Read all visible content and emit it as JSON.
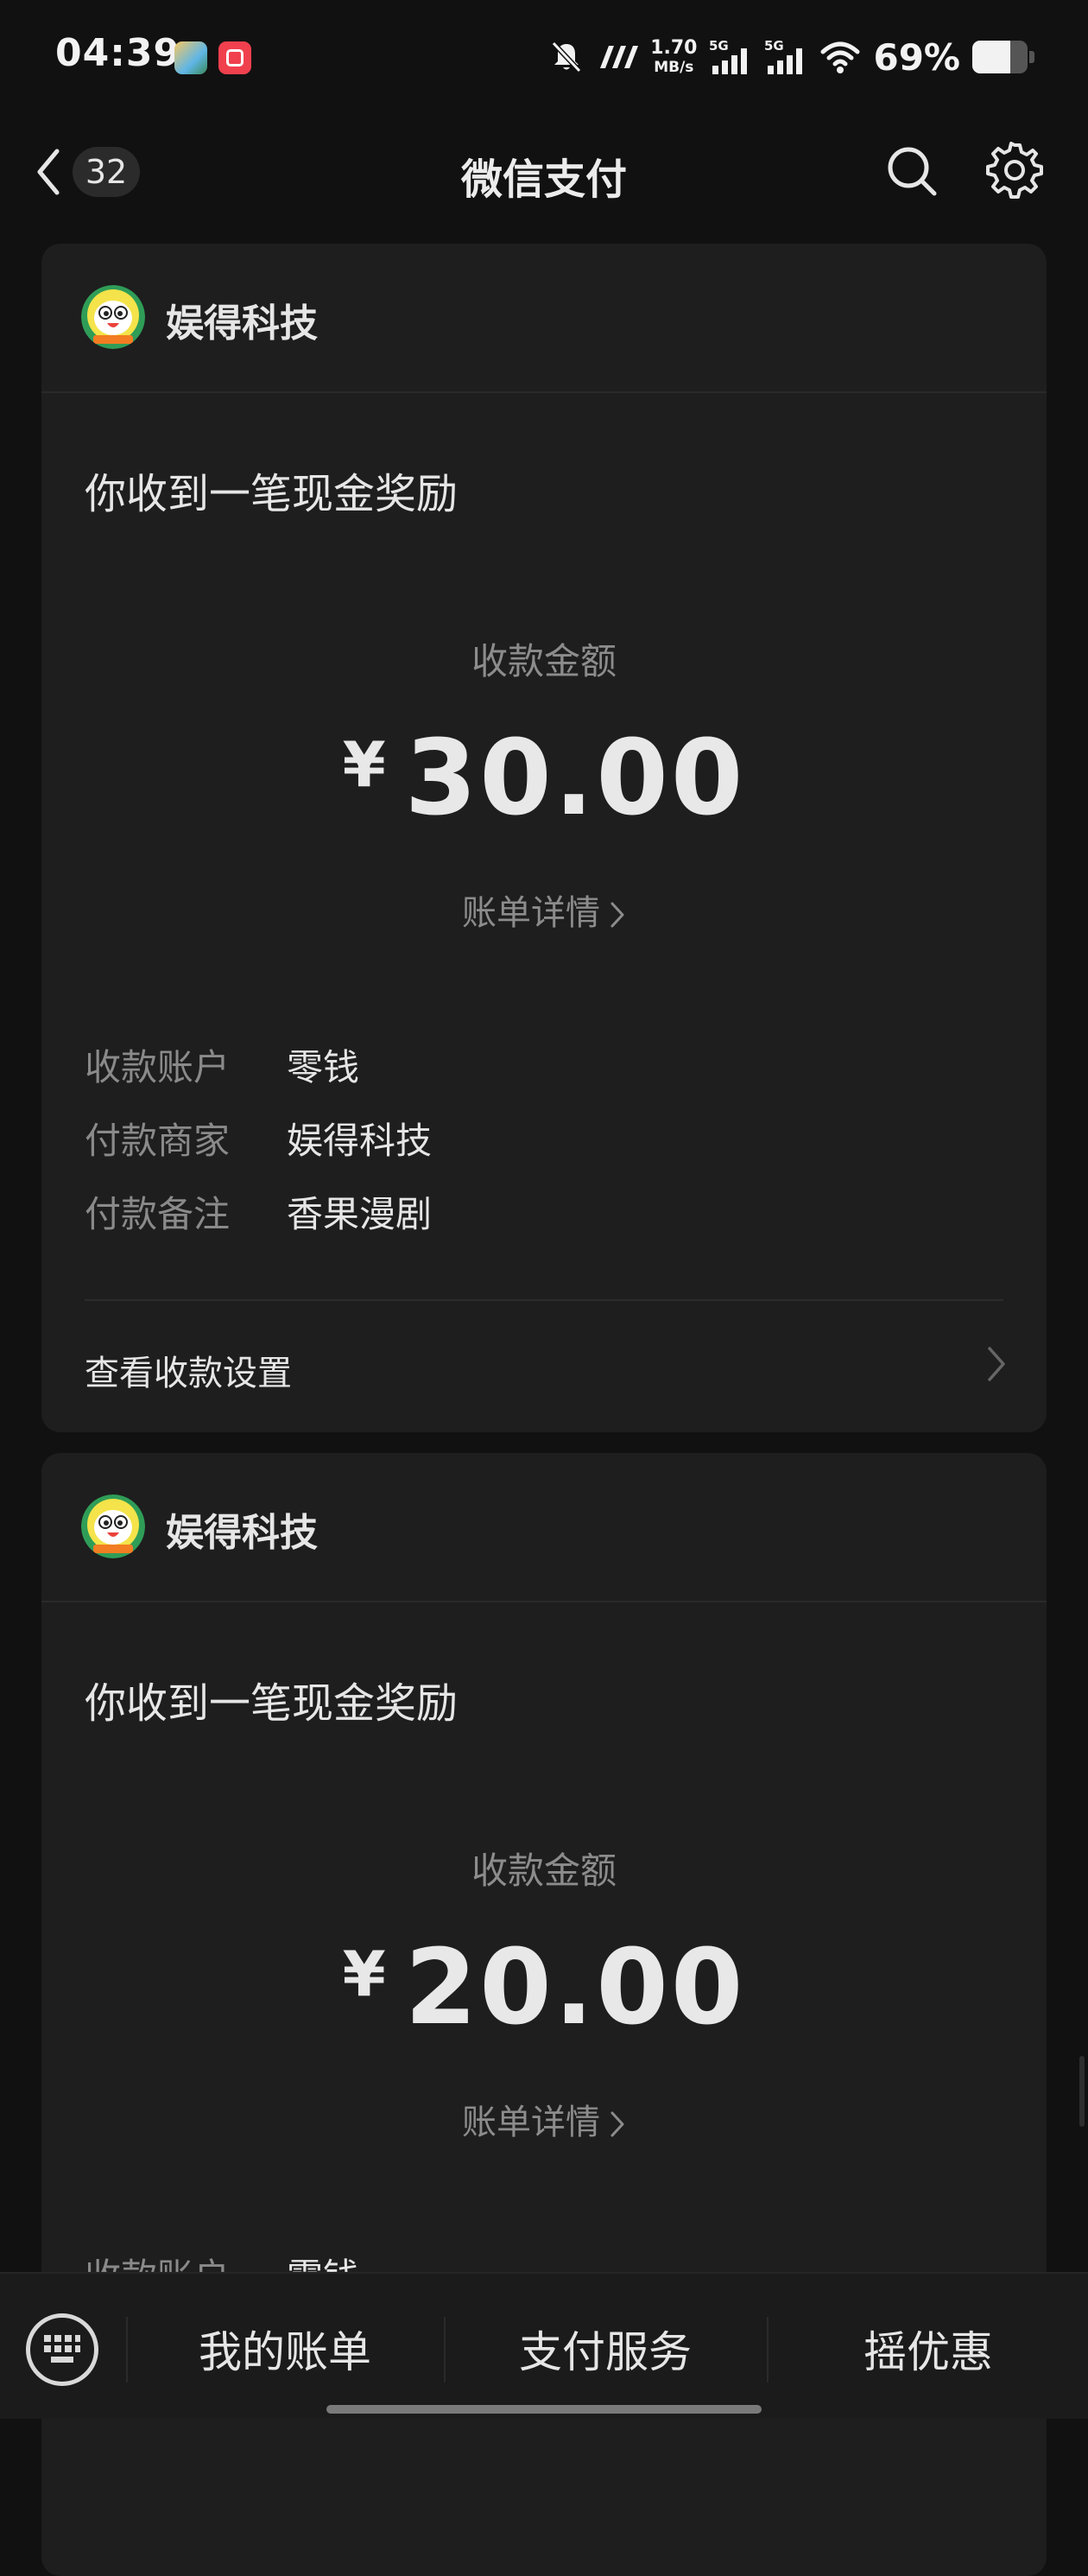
{
  "status_bar": {
    "time": "04:39",
    "net_speed_value": "1.70",
    "net_speed_unit": "MB/s",
    "signal_1_label": "5G",
    "signal_2_label": "5G",
    "battery_percent_text": "69%",
    "battery_level": 0.69,
    "icons": [
      "app-icon-game",
      "app-icon-red",
      "mute-bell-icon",
      "carrier-logo-icon",
      "signal-icon",
      "signal-icon",
      "wifi-icon",
      "battery-icon"
    ]
  },
  "nav": {
    "back_count": "32",
    "title": "微信支付",
    "icons": [
      "back-chevron-icon",
      "search-icon",
      "gear-icon"
    ]
  },
  "cards": [
    {
      "merchant": "娱得科技",
      "headline": "你收到一笔现金奖励",
      "amount_label": "收款金额",
      "currency": "¥",
      "amount": "30.00",
      "bill_link": "账单详情",
      "details": [
        {
          "key": "收款账户",
          "value": "零钱"
        },
        {
          "key": "付款商家",
          "value": "娱得科技"
        },
        {
          "key": "付款备注",
          "value": "香果漫剧"
        }
      ],
      "settings_link": "查看收款设置"
    },
    {
      "merchant": "娱得科技",
      "headline": "你收到一笔现金奖励",
      "amount_label": "收款金额",
      "currency": "¥",
      "amount": "20.00",
      "bill_link": "账单详情",
      "details": [
        {
          "key": "收款账户",
          "value": "零钱"
        }
      ]
    }
  ],
  "bottom_bar": {
    "tabs": [
      "我的账单",
      "支付服务",
      "摇优惠"
    ],
    "icons": [
      "keyboard-icon"
    ]
  }
}
